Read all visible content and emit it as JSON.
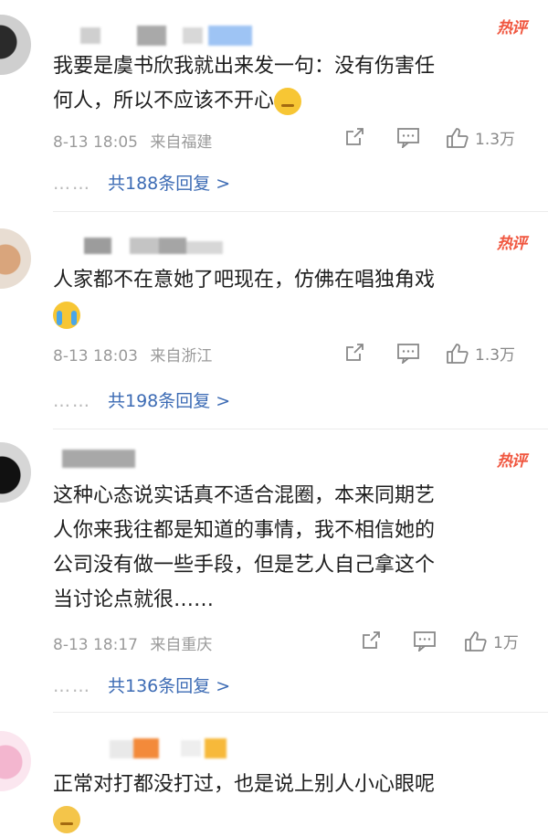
{
  "comments": [
    {
      "text_line1": "我要是虞书欣我就出来发一句：没有伤害任",
      "text_line2": "何人，所以不应该不开心",
      "emoji": "thinking-face-emoji",
      "hot_tag": "热评",
      "date": "8-13 18:05",
      "source": "来自福建",
      "likes": "1.3万",
      "replies": "共188条回复 >"
    },
    {
      "text_line1": "人家都不在意她了吧现在，仿佛在唱独角戏",
      "text_line2": "",
      "emoji": "loudly-crying-face-emoji",
      "hot_tag": "热评",
      "date": "8-13 18:03",
      "source": "来自浙江",
      "likes": "1.3万",
      "replies": "共198条回复 >"
    },
    {
      "text_line1": "这种心态说实话真不适合混圈，本来同期艺",
      "text_line2": "人你来我往都是知道的事情，我不相信她的",
      "text_line3": "公司没有做一些手段，但是艺人自己拿这个",
      "text_line4": "当讨论点就很……",
      "hot_tag": "热评",
      "date": "8-13 18:17",
      "source": "来自重庆",
      "likes": "1万",
      "replies": "共136条回复 >"
    },
    {
      "text_line1": "正常对打都没打过，也是说上别人小心眼呢",
      "emoji": "face-emoji"
    }
  ],
  "reply_dots": "……",
  "colors": {
    "hot": "#f0563f",
    "link": "#3c6bb4",
    "meta": "#9a9a9a"
  }
}
